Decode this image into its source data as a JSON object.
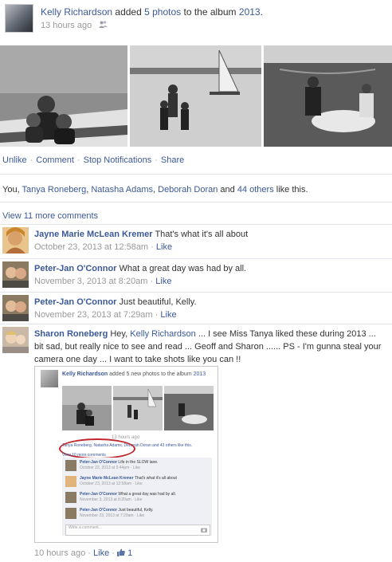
{
  "post": {
    "author": "Kelly Richardson",
    "verb_prefix": "added",
    "photo_count_link": "5 photos",
    "verb_middle": "to the album",
    "album": "2013",
    "time": "13 hours ago"
  },
  "actions": {
    "unlike": "Unlike",
    "comment": "Comment",
    "stop_notifications": "Stop Notifications",
    "share": "Share"
  },
  "likes": {
    "prefix": "You,",
    "names": [
      "Tanya Roneberg",
      "Natasha Adams",
      "Deborah Doran"
    ],
    "and": "and",
    "others": "44 others",
    "suffix": "like this."
  },
  "view_more": "View 11 more comments",
  "comments": [
    {
      "name": "Jayne Marie McLean Kremer",
      "text": "That's what it's all about",
      "time": "October 23, 2013 at 12:58am",
      "like": "Like"
    },
    {
      "name": "Peter-Jan O'Connor",
      "text": "What a great day was had by all.",
      "time": "November 3, 2013 at 8:20am",
      "like": "Like"
    },
    {
      "name": "Peter-Jan O'Connor",
      "text": "Just beautiful, Kelly.",
      "time": "November 23, 2013 at 7:29am",
      "like": "Like"
    },
    {
      "name": "Sharon Roneberg",
      "text_before_link": "Hey,",
      "link": "Kelly Richardson",
      "text": "... I see Miss Tanya liked these during 2013 ... bit sad, but really nice to see and read ... Geoff and Sharon ...... PS - I'm gunna steal your camera one day ... I want to take shots like you can !!",
      "time": "10 hours ago",
      "like": "Like",
      "like_count": "1"
    }
  ],
  "embedded": {
    "author": "Kelly Richardson",
    "action": "added 5 new photos to the album",
    "album": "2013",
    "time": "13 hours ago",
    "likes_line": "Tanya Roneberg, Natasha Adams, Deborah Doran and 43 others like this.",
    "view_more": "View 10 more comments",
    "comments": [
      {
        "name": "Peter-Jan O'Connor",
        "text": "Life in the SLOW lane.",
        "time": "October 22, 2013 at 5:44pm · Like"
      },
      {
        "name": "Jayne Marie McLean Kremer",
        "text": "That's what it's all about",
        "time": "October 23, 2013 at 12:58am · Like"
      },
      {
        "name": "Peter-Jan O'Connor",
        "text": "What a great day was had by all.",
        "time": "November 3, 2013 at 8:20am · Like"
      },
      {
        "name": "Peter-Jan O'Connor",
        "text": "Just beautiful, Kelly.",
        "time": "November 23, 2013 at 7:29am · Like"
      }
    ],
    "write_placeholder": "Write a comment..."
  },
  "colors": {
    "link": "#3b5998",
    "meta": "#999999",
    "divider": "#e1e4ea",
    "highlight_circle": "#c0282d"
  },
  "icons": [
    "people-icon",
    "thumbs-up-icon",
    "camera-icon"
  ]
}
